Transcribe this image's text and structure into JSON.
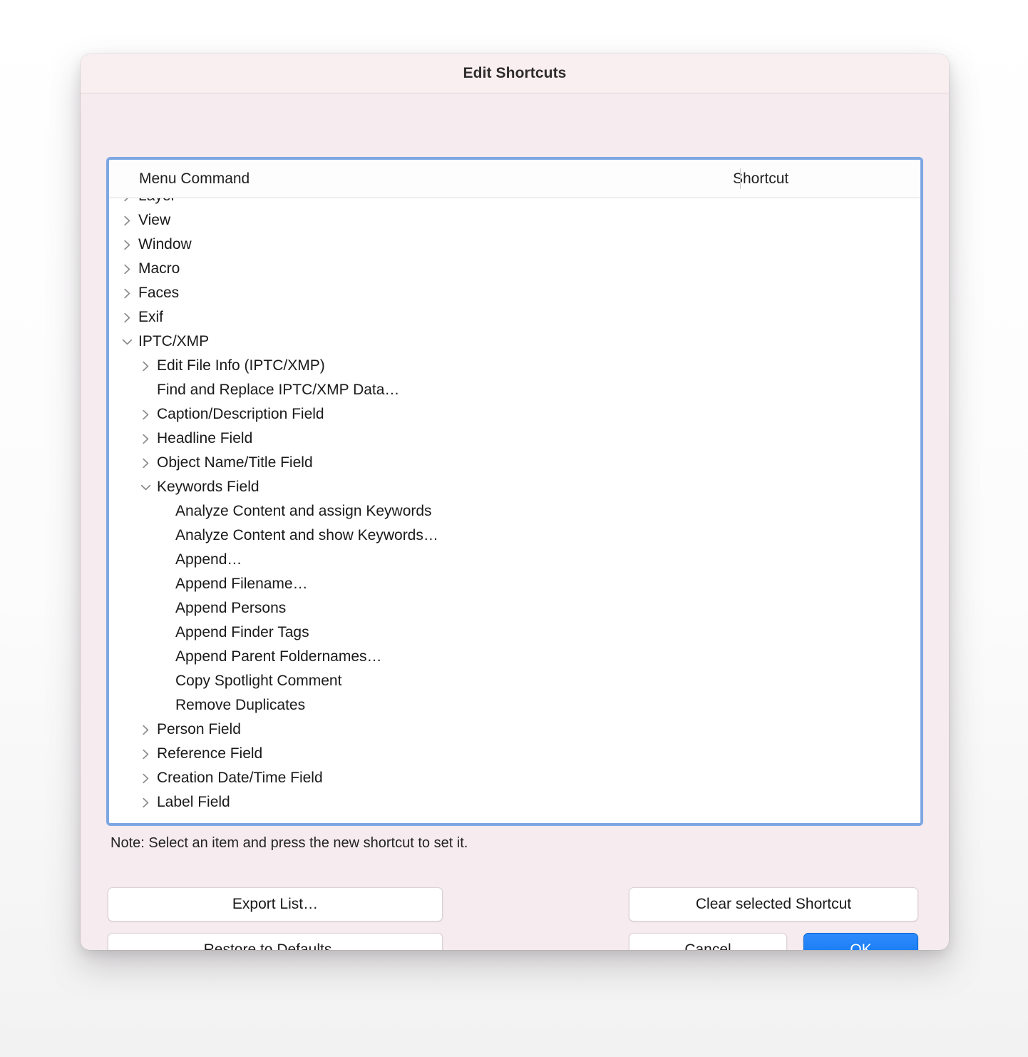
{
  "window": {
    "title": "Edit Shortcuts"
  },
  "colors": {
    "dialog_background": "#f6ebee",
    "titlebar_background": "#f9eff1",
    "focus_ring": "#7da7e3",
    "list_background": "#ffffff",
    "primary_button": "#0a74f0",
    "chevron": "#8b8b8b",
    "text": "#1a1a1a"
  },
  "table": {
    "columns": [
      {
        "label": "Menu Command"
      },
      {
        "label": "Shortcut"
      }
    ],
    "rows": [
      {
        "level": 0,
        "label": "Layer",
        "chevron": "collapsed",
        "shortcut": "",
        "clipped": true
      },
      {
        "level": 0,
        "label": "View",
        "chevron": "collapsed",
        "shortcut": ""
      },
      {
        "level": 0,
        "label": "Window",
        "chevron": "collapsed",
        "shortcut": ""
      },
      {
        "level": 0,
        "label": "Macro",
        "chevron": "collapsed",
        "shortcut": ""
      },
      {
        "level": 0,
        "label": "Faces",
        "chevron": "collapsed",
        "shortcut": ""
      },
      {
        "level": 0,
        "label": "Exif",
        "chevron": "collapsed",
        "shortcut": ""
      },
      {
        "level": 0,
        "label": "IPTC/XMP",
        "chevron": "expanded",
        "shortcut": ""
      },
      {
        "level": 1,
        "label": "Edit File Info (IPTC/XMP)",
        "chevron": "collapsed",
        "shortcut": ""
      },
      {
        "level": 1,
        "label": "Find and Replace IPTC/XMP Data…",
        "chevron": "none",
        "shortcut": ""
      },
      {
        "level": 1,
        "label": "Caption/Description Field",
        "chevron": "collapsed",
        "shortcut": ""
      },
      {
        "level": 1,
        "label": "Headline Field",
        "chevron": "collapsed",
        "shortcut": ""
      },
      {
        "level": 1,
        "label": "Object Name/Title Field",
        "chevron": "collapsed",
        "shortcut": ""
      },
      {
        "level": 1,
        "label": "Keywords Field",
        "chevron": "expanded",
        "shortcut": ""
      },
      {
        "level": 2,
        "label": "Analyze Content and assign Keywords",
        "chevron": "none",
        "shortcut": ""
      },
      {
        "level": 2,
        "label": "Analyze Content and show Keywords…",
        "chevron": "none",
        "shortcut": ""
      },
      {
        "level": 2,
        "label": "Append…",
        "chevron": "none",
        "shortcut": ""
      },
      {
        "level": 2,
        "label": "Append Filename…",
        "chevron": "none",
        "shortcut": ""
      },
      {
        "level": 2,
        "label": "Append Persons",
        "chevron": "none",
        "shortcut": ""
      },
      {
        "level": 2,
        "label": "Append Finder Tags",
        "chevron": "none",
        "shortcut": ""
      },
      {
        "level": 2,
        "label": "Append Parent Foldernames…",
        "chevron": "none",
        "shortcut": ""
      },
      {
        "level": 2,
        "label": "Copy Spotlight Comment",
        "chevron": "none",
        "shortcut": ""
      },
      {
        "level": 2,
        "label": "Remove Duplicates",
        "chevron": "none",
        "shortcut": ""
      },
      {
        "level": 1,
        "label": "Person Field",
        "chevron": "collapsed",
        "shortcut": ""
      },
      {
        "level": 1,
        "label": "Reference Field",
        "chevron": "collapsed",
        "shortcut": ""
      },
      {
        "level": 1,
        "label": "Creation Date/Time Field",
        "chevron": "collapsed",
        "shortcut": ""
      },
      {
        "level": 1,
        "label": "Label Field",
        "chevron": "collapsed",
        "shortcut": ""
      }
    ]
  },
  "note": {
    "text": "Note: Select an item and press the new shortcut to set it."
  },
  "buttons": {
    "export_list": "Export List…",
    "restore_defaults": "Restore to Defaults…",
    "clear_selected_shortcut": "Clear selected Shortcut",
    "cancel": "Cancel",
    "ok": "OK"
  }
}
